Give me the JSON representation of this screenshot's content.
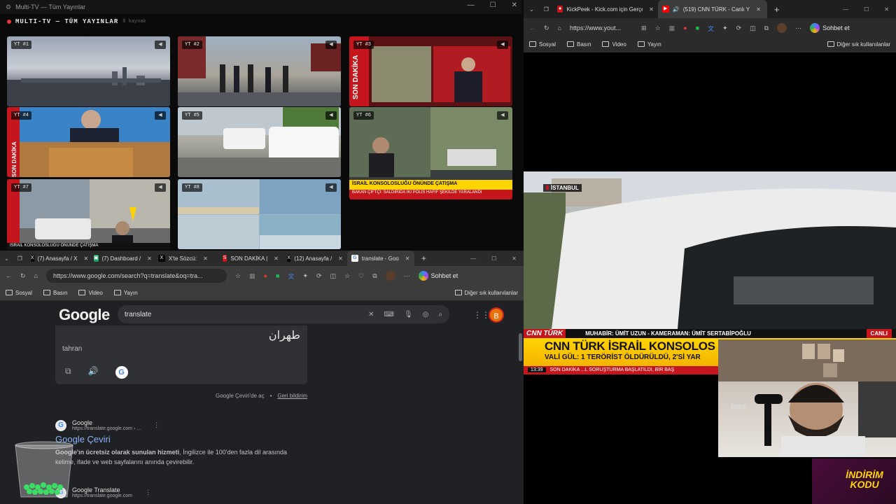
{
  "multitv": {
    "window_title": "Multi-TV — Tüm Yayınlar",
    "header": "MULTI-TV — TÜM YAYINLAR",
    "source_count": "8 kaynak",
    "tiles": [
      {
        "label": "YT #1"
      },
      {
        "label": "YT #2"
      },
      {
        "label": "YT #3"
      },
      {
        "label": "YT #4"
      },
      {
        "label": "YT #5"
      },
      {
        "label": "YT #6"
      },
      {
        "label": "YT #7"
      },
      {
        "label": "YT #8"
      }
    ],
    "tile3_text": "SON DAKİKA",
    "tile4_text": "SON DAKİKA",
    "tile6_ticker": "İSRAİL KONSOLOSLUĞU ÖNÜNDE ÇATIŞMA",
    "tile6_ticker2": "BAKAN ÇİFTÇİ: SALDIRIDA İKİ POLİS HAFİF ŞEKİLDE YARALANDI",
    "tile7_ticker": "İSRAİL KONSOLOSLUĞU ÖNÜNDE ÇATIŞMA"
  },
  "left_browser": {
    "tabs": [
      {
        "label": "(7) Anasayfa / X"
      },
      {
        "label": "(7) Dashboard /"
      },
      {
        "label": "X'te Sözcü:"
      },
      {
        "label": "SON DAKİKA |"
      },
      {
        "label": "(12) Anasayfa /"
      },
      {
        "label": "translate - Goo"
      }
    ],
    "url": "https://www.google.com/search?q=translate&oq=tra...",
    "profile_button": "Sohbet et",
    "bookmarks": [
      "Sosyal",
      "Basın",
      "Video",
      "Yayın"
    ],
    "bookmarks_right": "Diğer sık kullanılanlar",
    "google": {
      "logo": "Google",
      "query": "translate",
      "avatar_letter": "B",
      "translated_text": "طهران",
      "transliteration": "tahran",
      "footer_left": "Google Çeviri'de aç",
      "footer_right": "Geri bildirim",
      "result1_site": "Google",
      "result1_url": "https://translate.google.com › ...",
      "result1_title": "Google Çeviri",
      "result1_desc_bold": "Google'ın ücretsiz olarak sunulan hizmeti",
      "result1_desc_rest": ", İngilizce ile 100'den fazla dil arasında",
      "result1_desc_line2": "kelime, ifade ve web sayfalarını anında çevirebilir.",
      "result2_site": "Google Translate",
      "result2_url": "https://translate.google.com"
    }
  },
  "right_browser": {
    "tabs": [
      {
        "label": "KickPeek - Kick.com için Gerçek Za"
      },
      {
        "label": "(519) CNN TÜRK - Canlı Y"
      }
    ],
    "url": "https://www.yout...",
    "profile_button": "Sohbet et",
    "bookmarks": [
      "Sosyal",
      "Basın",
      "Video",
      "Yayın"
    ],
    "bookmarks_right": "Diğer sık kullanılanlar",
    "video": {
      "location_tag": "İSTANBUL",
      "channel_logo": "CNN TÜRK",
      "crew": "MUHABİR: ÜMİT UZUN - KAMERAMAN: ÜMİT SERTABİPOĞLU",
      "live": "CANLI",
      "headline": "CNN TÜRK İSRAİL KONSOLOS",
      "subheadline": "VALİ GÜL: 1 TERÖRİST ÖLDÜRÜLDÜ, 2'Sİ YAR",
      "time": "13:39",
      "strip": "SON DAKİKA  ...L SORUŞTURMA BAŞLATILDI, BİR BAŞ",
      "mic_label": "RØDE",
      "promo": "İNDİRİM KODU"
    }
  }
}
